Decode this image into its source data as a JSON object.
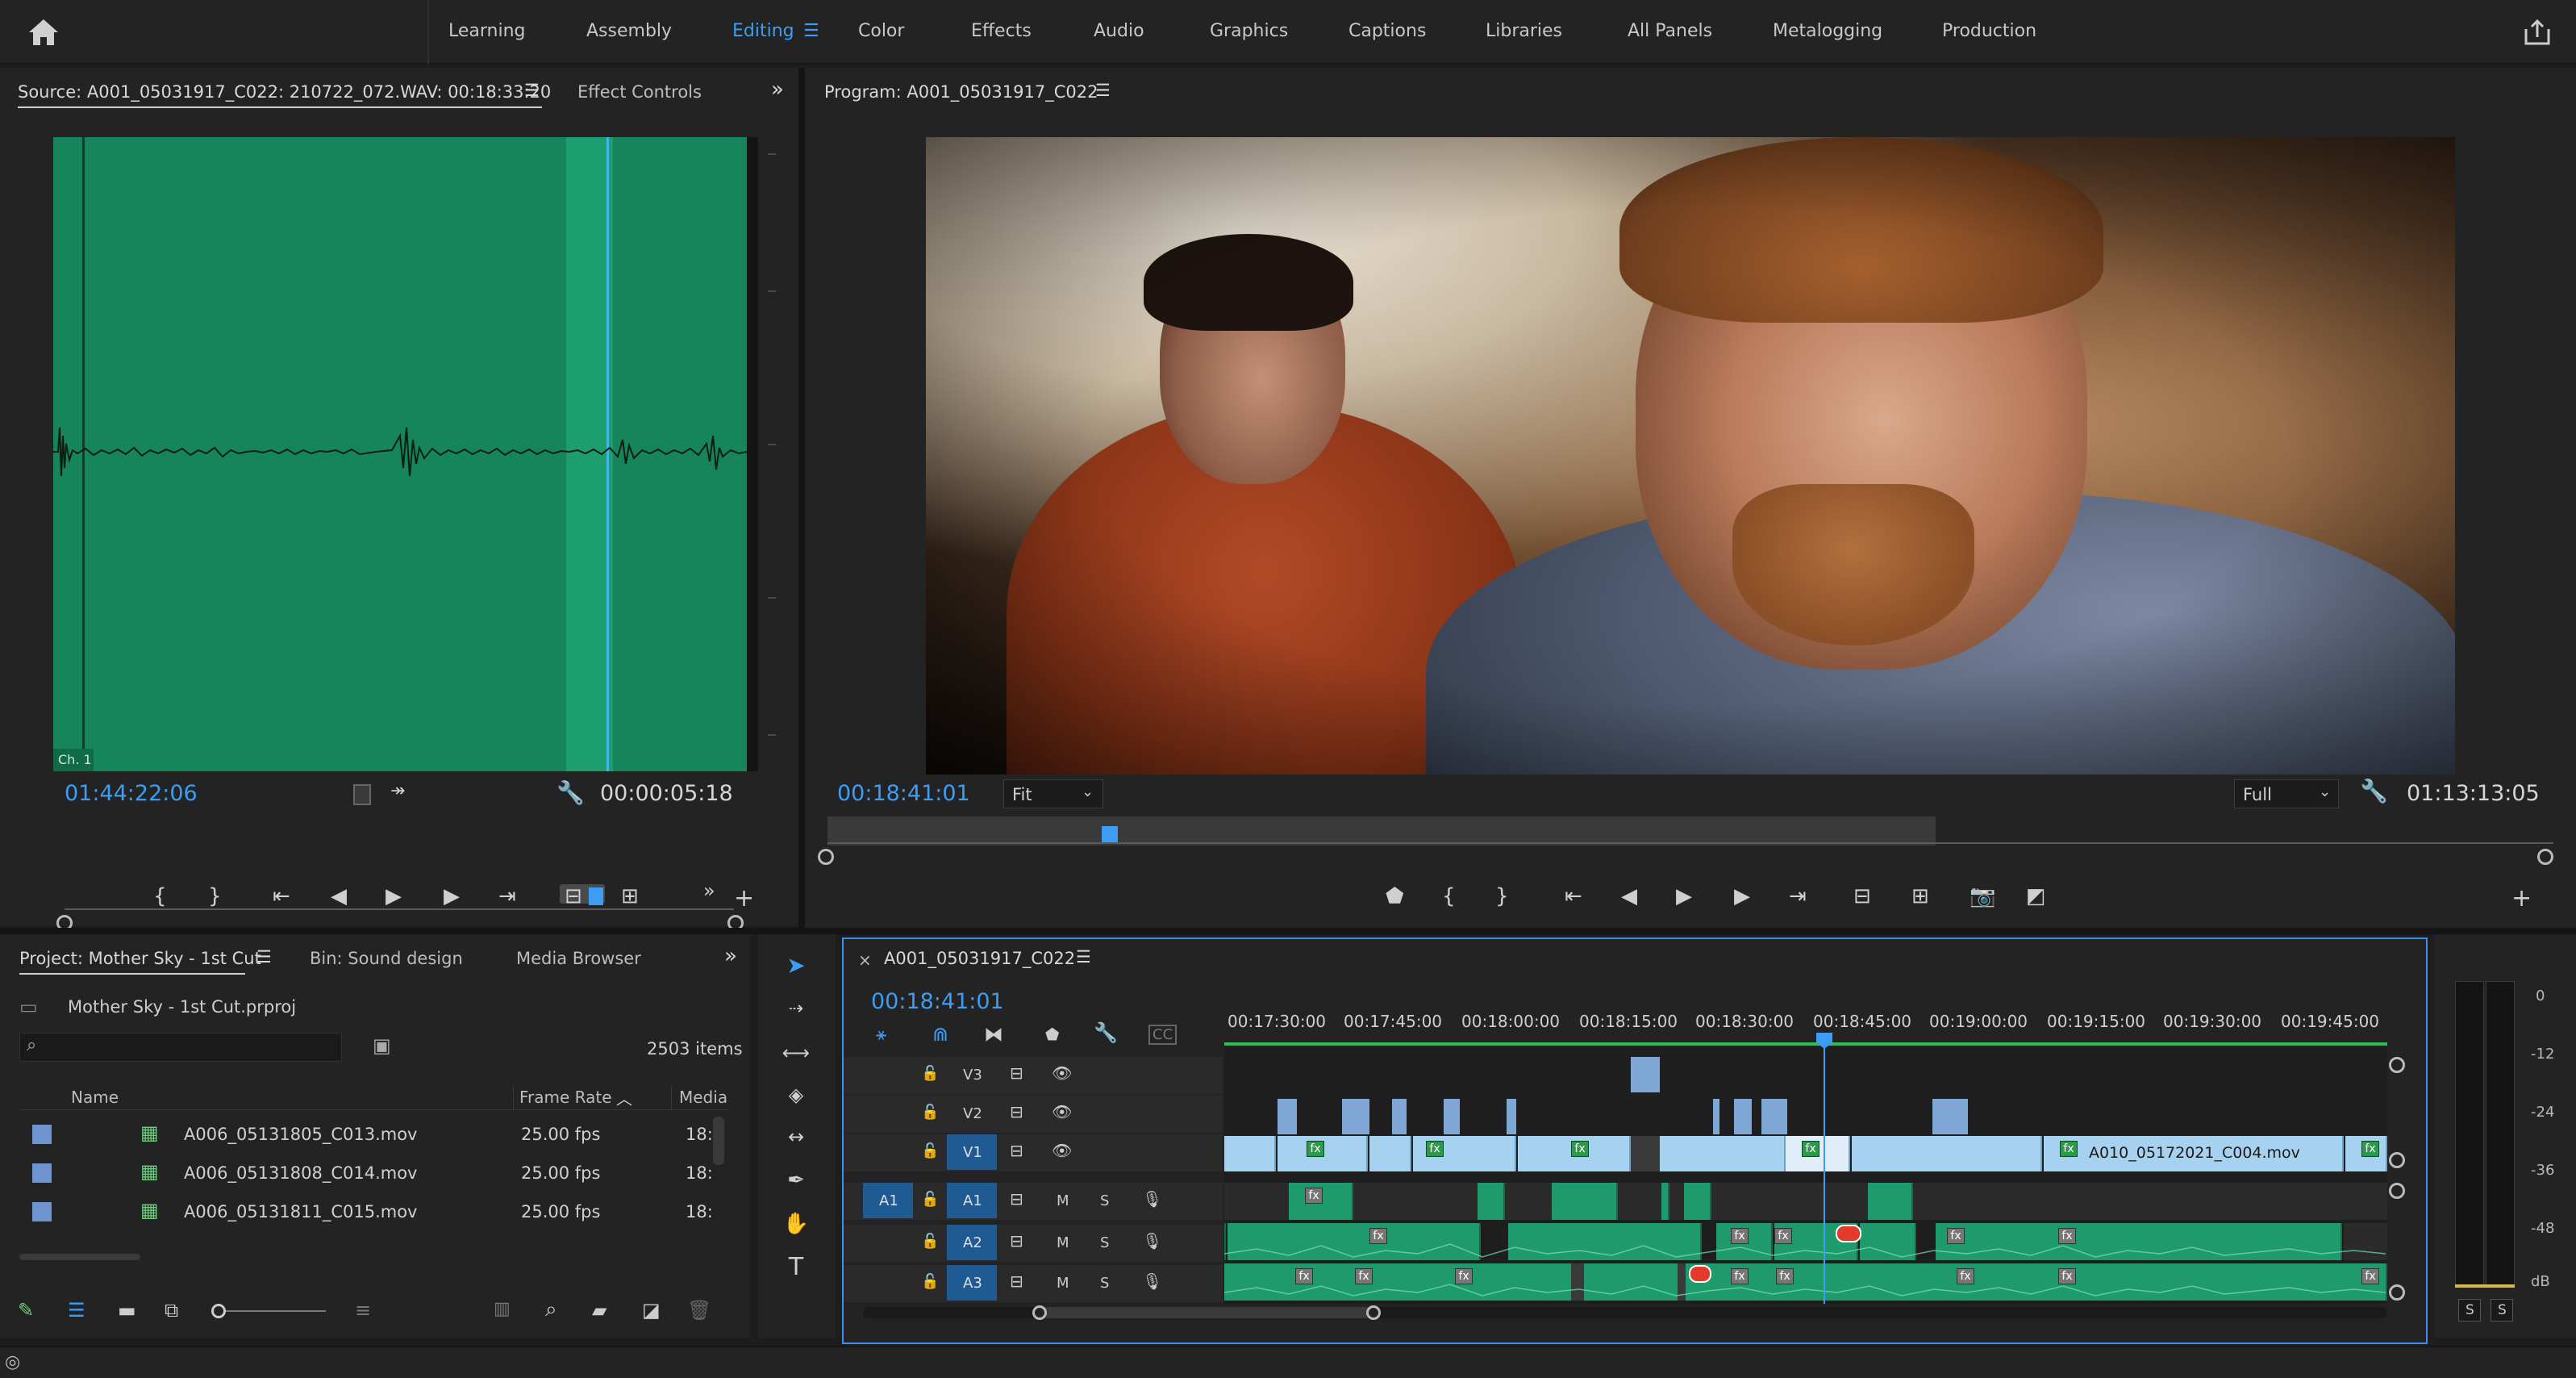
{
  "workspaces": {
    "tabs": [
      "Learning",
      "Assembly",
      "Editing",
      "Color",
      "Effects",
      "Audio",
      "Graphics",
      "Captions",
      "Libraries",
      "All Panels",
      "Metalogging",
      "Production"
    ],
    "active": "Editing"
  },
  "source_panel": {
    "title": "Source: A001_05031917_C022: 210722_072.WAV: 00:18:33:20",
    "tab2": "Effect Controls",
    "channel_label": "Ch. 1",
    "timecode_left": "01:44:22:06",
    "timecode_right": "00:00:05:18"
  },
  "program_panel": {
    "title": "Program: A001_05031917_C022",
    "timecode_left": "00:18:41:01",
    "zoom": "Fit",
    "quality": "Full",
    "timecode_right": "01:13:13:05"
  },
  "project_panel": {
    "tab1": "Project: Mother Sky - 1st Cut",
    "tab2": "Bin: Sound design",
    "tab3": "Media Browser",
    "project_file": "Mother Sky - 1st Cut.prproj",
    "item_count": "2503 items",
    "columns": {
      "name": "Name",
      "frame_rate": "Frame Rate",
      "media": "Media"
    },
    "rows": [
      {
        "name": "A006_05131805_C013.mov",
        "fps": "25.00 fps",
        "media": "18:"
      },
      {
        "name": "A006_05131808_C014.mov",
        "fps": "25.00 fps",
        "media": "18:"
      },
      {
        "name": "A006_05131811_C015.mov",
        "fps": "25.00 fps",
        "media": "18:"
      }
    ]
  },
  "timeline": {
    "sequence_name": "A001_05031917_C022",
    "timecode": "00:18:41:01",
    "ruler_labels": [
      "00:17:30:00",
      "00:17:45:00",
      "00:18:00:00",
      "00:18:15:00",
      "00:18:30:00",
      "00:18:45:00",
      "00:19:00:00",
      "00:19:15:00",
      "00:19:30:00",
      "00:19:45:00"
    ],
    "video_tracks": [
      "V3",
      "V2",
      "V1"
    ],
    "audio_tracks": [
      "A1",
      "A2",
      "A3"
    ],
    "source_patch": "A1",
    "mute_label": "M",
    "solo_label": "S",
    "clip_label": "A010_05172021_C004.mov",
    "fx_label": "fx"
  },
  "meter": {
    "labels": [
      "0",
      "-12",
      "-24",
      "-36",
      "-48",
      "dB"
    ],
    "solo_buttons": [
      "S",
      "S"
    ]
  },
  "colors": {
    "accent": "#3d9df5",
    "audio_clip": "#1f9a6c",
    "video_clip": "#a7d2ef",
    "source_wave_bg": "#16855c"
  }
}
